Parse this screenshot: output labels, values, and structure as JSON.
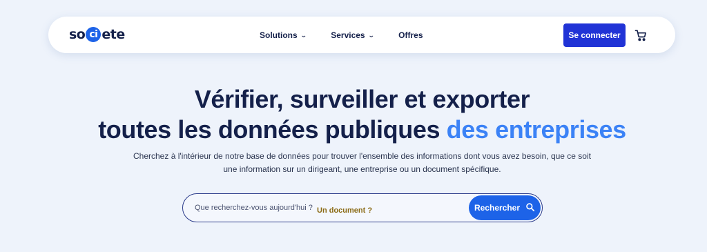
{
  "header": {
    "logo": {
      "before": "so",
      "dot": "ci",
      "after": "ete"
    },
    "nav": [
      {
        "label": "Solutions",
        "dropdown": true
      },
      {
        "label": "Services",
        "dropdown": true
      },
      {
        "label": "Offres",
        "dropdown": false
      }
    ],
    "login_label": "Se connecter",
    "cart_icon": "cart-icon"
  },
  "hero": {
    "title_line1": "Vérifier, surveiller et exporter",
    "title_line2_main": "toutes les données publiques ",
    "title_line2_accent": "des entreprises",
    "subtitle_line1": "Cherchez à l'intérieur de notre base de données pour trouver l'ensemble des informations dont vous avez besoin, que ce soit",
    "subtitle_line2": "une information sur un dirigeant, une entreprise ou un document spécifique."
  },
  "search": {
    "placeholder": "Que recherchez-vous aujourd'hui ?",
    "rotating_hint": "Un document ?",
    "button_label": "Rechercher"
  },
  "colors": {
    "background": "#eef3fb",
    "primary_dark": "#14204a",
    "login_button": "#2033d6",
    "accent_blue": "#3b82f6",
    "search_button": "#1d63e8",
    "hint_text": "#8a6a14"
  }
}
